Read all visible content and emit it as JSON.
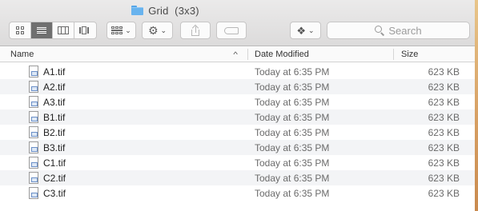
{
  "window": {
    "title": "Grid  (3x3)"
  },
  "toolbar": {
    "view_modes": [
      {
        "icon": "icon-view-grid-icon",
        "active": false
      },
      {
        "icon": "list-view-icon",
        "active": true
      },
      {
        "icon": "column-view-icon",
        "active": false
      },
      {
        "icon": "cover-flow-view-icon",
        "active": false
      }
    ],
    "arrange_icon": "arrange-icon",
    "action_icon": "gear-icon",
    "share_icon": "share-icon",
    "tags_icon": "tag-icon",
    "dropbox_icon": "dropbox-icon",
    "search_placeholder": "Search"
  },
  "list": {
    "columns": {
      "name": "Name",
      "date": "Date Modified",
      "size": "Size"
    },
    "files": [
      {
        "name": "A1.tif",
        "date": "Today at 6:35 PM",
        "size": "623 KB"
      },
      {
        "name": "A2.tif",
        "date": "Today at 6:35 PM",
        "size": "623 KB"
      },
      {
        "name": "A3.tif",
        "date": "Today at 6:35 PM",
        "size": "623 KB"
      },
      {
        "name": "B1.tif",
        "date": "Today at 6:35 PM",
        "size": "623 KB"
      },
      {
        "name": "B2.tif",
        "date": "Today at 6:35 PM",
        "size": "623 KB"
      },
      {
        "name": "B3.tif",
        "date": "Today at 6:35 PM",
        "size": "623 KB"
      },
      {
        "name": "C1.tif",
        "date": "Today at 6:35 PM",
        "size": "623 KB"
      },
      {
        "name": "C2.tif",
        "date": "Today at 6:35 PM",
        "size": "623 KB"
      },
      {
        "name": "C3.tif",
        "date": "Today at 6:35 PM",
        "size": "623 KB"
      }
    ]
  },
  "colors": {
    "folder": "#68b3ee",
    "active_segment": "#6f6f6f",
    "row_alt": "#f3f4f6"
  }
}
